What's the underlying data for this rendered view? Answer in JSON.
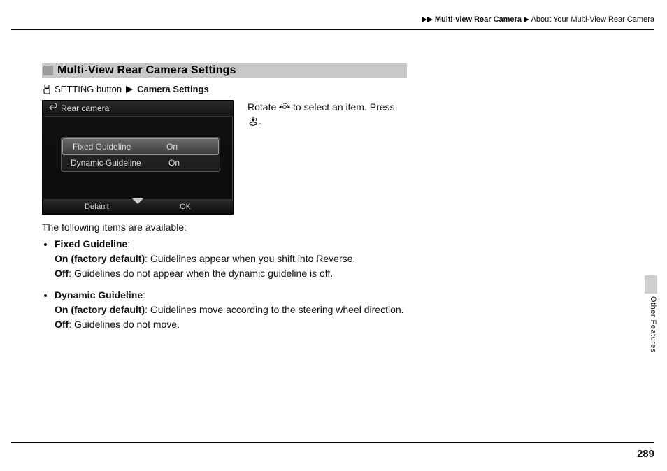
{
  "breadcrumb": {
    "level1": "Multi-view Rear Camera",
    "level2": "About Your Multi-View Rear Camera"
  },
  "section": {
    "title": "Multi-View Rear Camera Settings",
    "nav_pre": "SETTING button",
    "nav_post": "Camera Settings"
  },
  "screenshot": {
    "title": "Rear camera",
    "rows": [
      {
        "label": "Fixed Guideline",
        "value": "On"
      },
      {
        "label": "Dynamic Guideline",
        "value": "On"
      }
    ],
    "footer_left": "Default",
    "footer_right": "OK"
  },
  "instruction": {
    "pre": "Rotate",
    "mid": "to select an item. Press",
    "post": "."
  },
  "available_intro": "The following items are available:",
  "items": [
    {
      "name": "Fixed Guideline",
      "on_label": "On (factory default)",
      "on_text": ": Guidelines appear when you shift into Reverse.",
      "off_label": "Off",
      "off_text": ": Guidelines do not appear when the dynamic guideline is off."
    },
    {
      "name": "Dynamic Guideline",
      "on_label": "On (factory default)",
      "on_text": ": Guidelines move according to the steering wheel direction.",
      "off_label": "Off",
      "off_text": ": Guidelines do not move."
    }
  ],
  "side_label": "Other Features",
  "page_number": "289"
}
